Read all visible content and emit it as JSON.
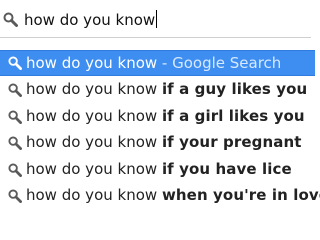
{
  "omnibox": {
    "value": "how do you know"
  },
  "suggestions": {
    "selected": {
      "typed": "how do you know",
      "provider_text": " - Google Search"
    },
    "items": [
      {
        "typed": "how do you know ",
        "completion": "if a guy likes you"
      },
      {
        "typed": "how do you know ",
        "completion": "if a girl likes you"
      },
      {
        "typed": "how do you know ",
        "completion": "if your pregnant"
      },
      {
        "typed": "how do you know ",
        "completion": "if you have lice"
      },
      {
        "typed": "how do you know ",
        "completion": "when you're in love"
      }
    ]
  },
  "colors": {
    "selection": "#3d8ef0",
    "icon": "#5a5a5a"
  }
}
